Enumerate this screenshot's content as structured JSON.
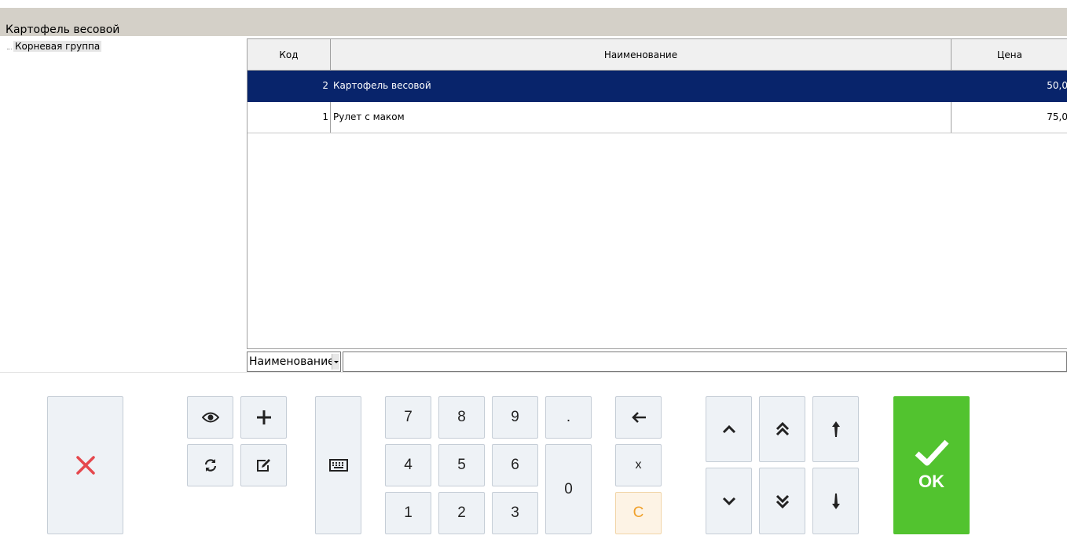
{
  "window": {
    "title": "Картофель весовой"
  },
  "tree": {
    "root_label": "Корневая группа"
  },
  "table": {
    "columns": [
      "Код",
      "Наименование",
      "Цена"
    ],
    "rows": [
      {
        "code": "2",
        "name": "Картофель весовой",
        "price": "50,0",
        "selected": true
      },
      {
        "code": "1",
        "name": "Рулет с маком",
        "price": "75,0",
        "selected": false
      }
    ]
  },
  "search": {
    "field_selected": "Наименование",
    "value": ""
  },
  "keypad": {
    "digits": {
      "d7": "7",
      "d8": "8",
      "d9": "9",
      "d4": "4",
      "d5": "5",
      "d6": "6",
      "d1": "1",
      "d2": "2",
      "d3": "3",
      "d0": "0",
      "dot": "."
    },
    "multiply": "x",
    "clear": "C"
  },
  "ok_button": {
    "label": "OK"
  },
  "colors": {
    "selected_row": "#08246b",
    "ok_green": "#52c32f",
    "cancel_red": "#e5484d",
    "clear_orange": "#f0a02a"
  }
}
